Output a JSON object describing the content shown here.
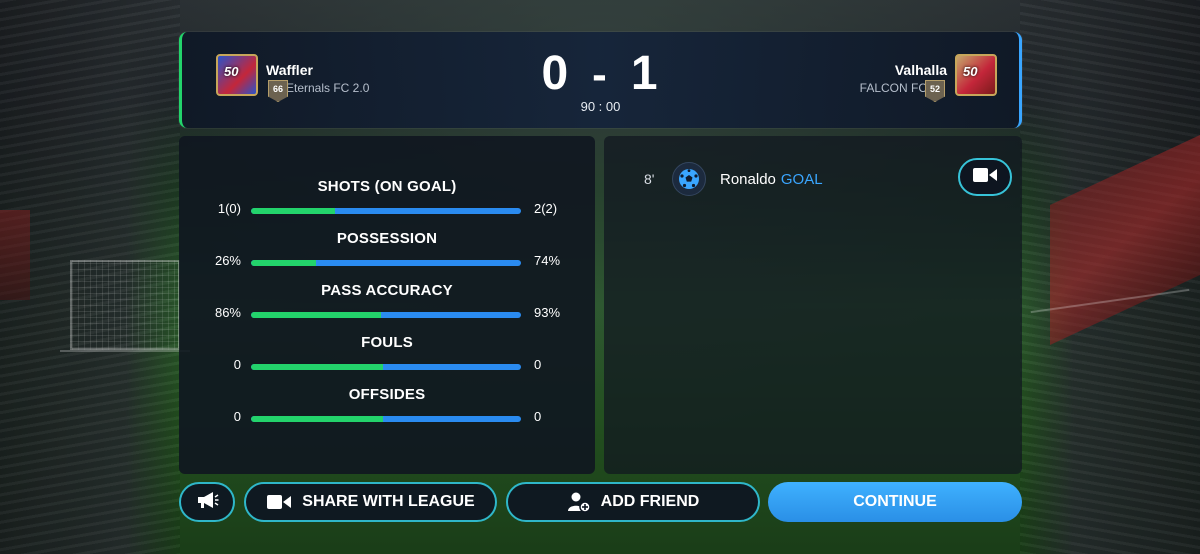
{
  "colors": {
    "home_accent": "#23d36b",
    "away_accent": "#3aa6ff",
    "goal_label": "#3aa6ff",
    "button_border": "#2fb7c9",
    "continue_bg": "#3aa6ff"
  },
  "home": {
    "badge_number": "50",
    "level": "66",
    "name": "Waffler",
    "club": "Eternals FC 2.0"
  },
  "away": {
    "badge_number": "50",
    "level": "52",
    "name": "Valhalla",
    "club": "FALCON FC"
  },
  "score": {
    "home": "0",
    "separator": "-",
    "away": "1",
    "clock": "90 : 00"
  },
  "stats": [
    {
      "title": "SHOTS (ON GOAL)",
      "left": "1(0)",
      "right": "2(2)",
      "home_share": 0.31
    },
    {
      "title": "POSSESSION",
      "left": "26%",
      "right": "74%",
      "home_share": 0.24
    },
    {
      "title": "PASS ACCURACY",
      "left": "86%",
      "right": "93%",
      "home_share": 0.48
    },
    {
      "title": "FOULS",
      "left": "0",
      "right": "0",
      "home_share": 0.49
    },
    {
      "title": "OFFSIDES",
      "left": "0",
      "right": "0",
      "home_share": 0.49
    }
  ],
  "events": [
    {
      "minute": "8'",
      "icon": "soccer-ball-icon",
      "player": "Ronaldo",
      "type": "GOAL"
    }
  ],
  "buttons": {
    "megaphone_icon": "megaphone-icon",
    "share_label": "SHARE WITH LEAGUE",
    "share_icon": "video-camera-icon",
    "friend_label": "ADD FRIEND",
    "friend_icon": "add-user-icon",
    "continue_label": "CONTINUE",
    "replay_icon": "video-camera-icon"
  }
}
